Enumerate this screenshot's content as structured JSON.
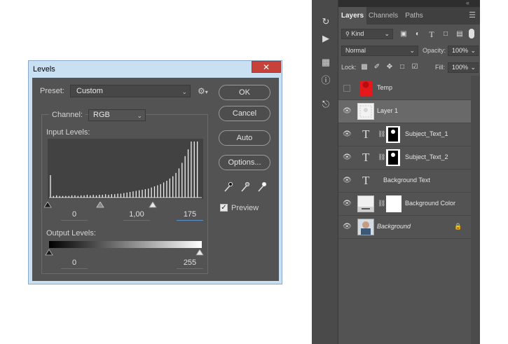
{
  "levels": {
    "title": "Levels",
    "close": "✕",
    "preset_label": "Preset:",
    "preset_value": "Custom",
    "channel_label": "Channel:",
    "channel_value": "RGB",
    "input_label": "Input Levels:",
    "input_values": [
      "0",
      "1,00",
      "175"
    ],
    "output_label": "Output Levels:",
    "output_values": [
      "0",
      "255"
    ],
    "buttons": {
      "ok": "OK",
      "cancel": "Cancel",
      "auto": "Auto",
      "options": "Options..."
    },
    "preview_label": "Preview",
    "preview_checked": true,
    "histogram_heights": [
      0.4,
      0.03,
      0.04,
      0.03,
      0.03,
      0.03,
      0.03,
      0.04,
      0.04,
      0.03,
      0.04,
      0.04,
      0.05,
      0.04,
      0.05,
      0.04,
      0.05,
      0.05,
      0.06,
      0.05,
      0.06,
      0.06,
      0.07,
      0.07,
      0.08,
      0.09,
      0.1,
      0.11,
      0.12,
      0.13,
      0.14,
      0.15,
      0.16,
      0.18,
      0.2,
      0.22,
      0.24,
      0.27,
      0.3,
      0.34,
      0.38,
      0.44,
      0.52,
      0.62,
      0.74,
      0.86,
      1.0,
      1.0,
      1.0
    ]
  },
  "layers_panel": {
    "tabs": [
      "Layers",
      "Channels",
      "Paths"
    ],
    "kind_label": "Kind",
    "blend_mode": "Normal",
    "opacity_label": "Opacity:",
    "opacity_value": "100%",
    "lock_label": "Lock:",
    "fill_label": "Fill:",
    "fill_value": "100%",
    "layers": [
      {
        "name": "Temp",
        "visible": false
      },
      {
        "name": "Layer 1",
        "visible": true,
        "selected": true
      },
      {
        "name": "Subject_Text_1",
        "visible": true
      },
      {
        "name": "Subject_Text_2",
        "visible": true
      },
      {
        "name": "Background Text",
        "visible": true
      },
      {
        "name": "Background Color",
        "visible": true
      },
      {
        "name": "Background",
        "visible": true,
        "locked": true
      }
    ]
  },
  "colors": {
    "dialog_bg": "#535353",
    "titlebar": "#c9dff2",
    "close_red": "#c8423c",
    "temp_red": "#e5191b"
  }
}
